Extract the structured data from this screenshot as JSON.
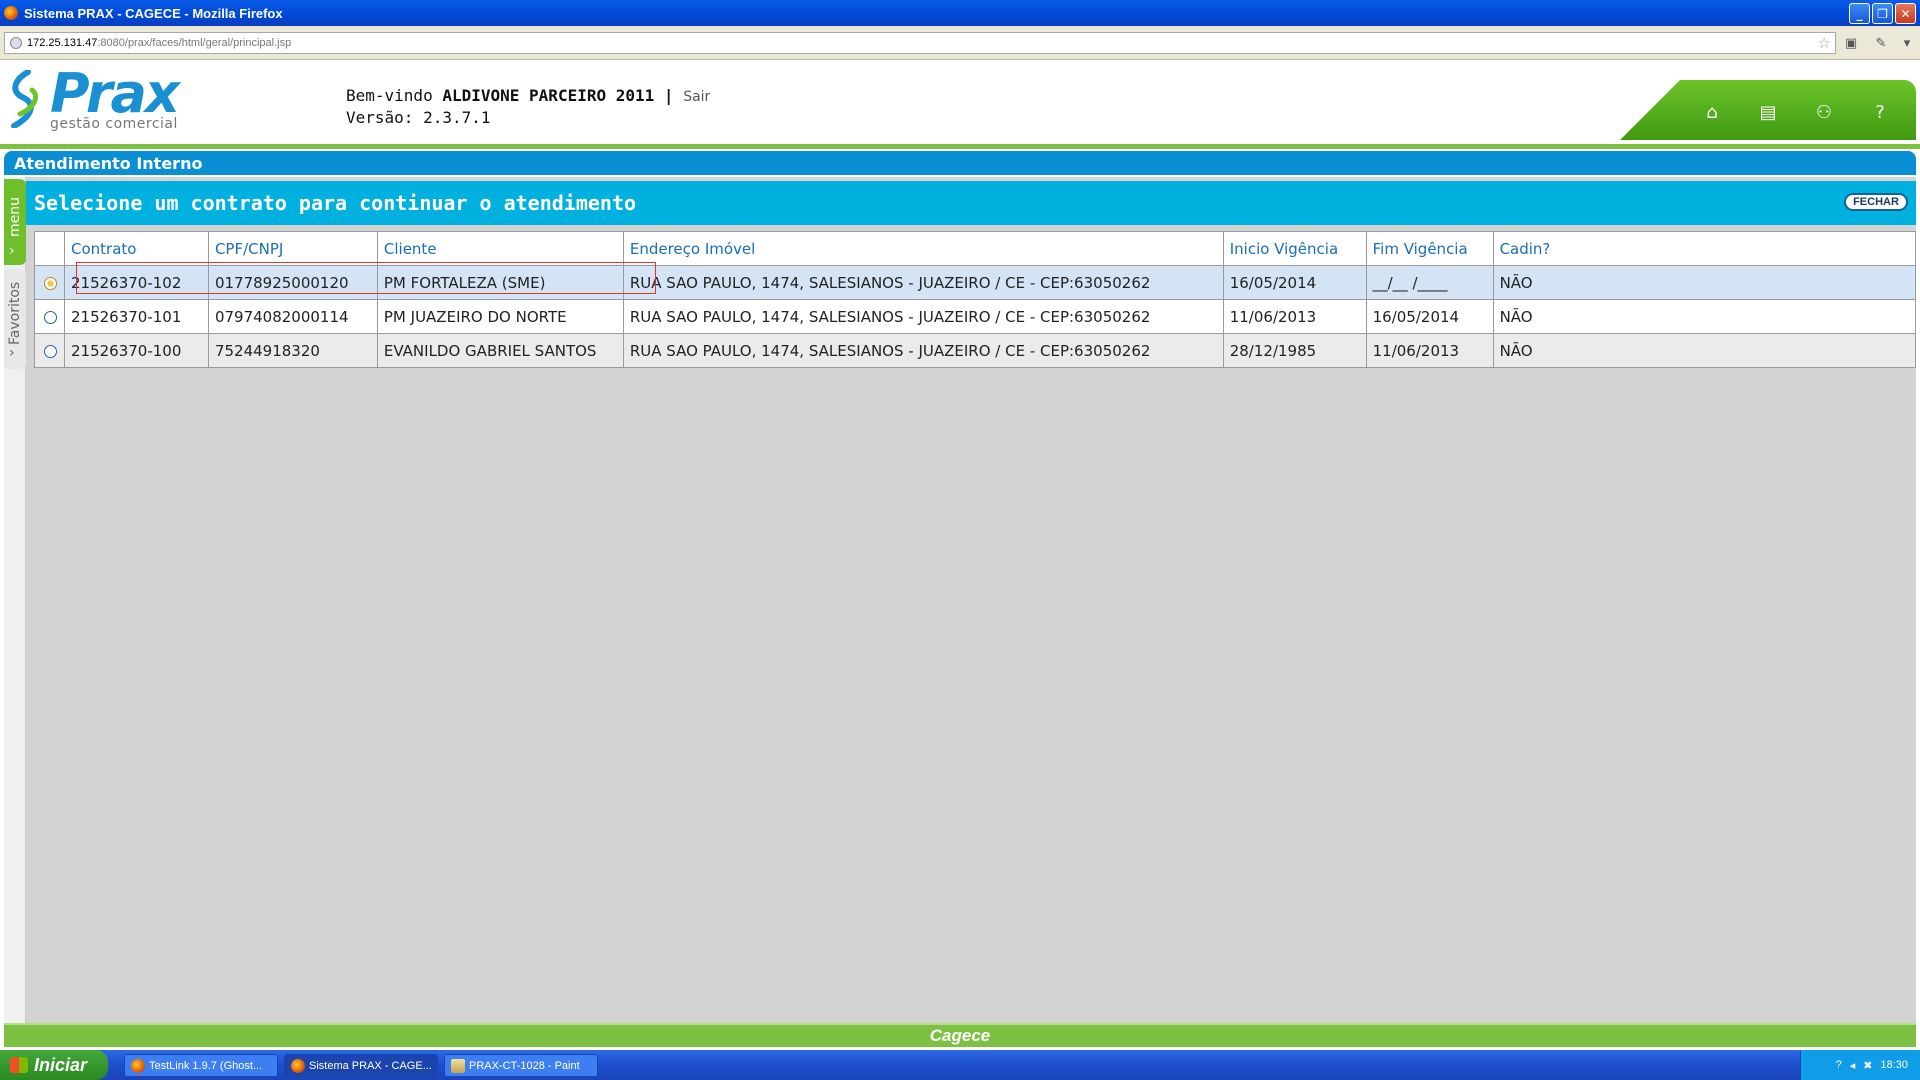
{
  "window": {
    "title": "Sistema PRAX - CAGECE - Mozilla Firefox",
    "buttons": {
      "minimize": "_",
      "maximize": "❐",
      "close": "✕"
    }
  },
  "browser": {
    "url_host": "172.25.131.47",
    "url_path": ":8080/prax/faces/html/geral/principal.jsp"
  },
  "header": {
    "logo_text": "Prax",
    "logo_subtitle": "gestão comercial",
    "welcome_prefix": "Bem-vindo",
    "user_name": "ALDIVONE PARCEIRO 2011",
    "separator": "|",
    "logout_label": "Sair",
    "version_label": "Versão: 2.3.7.1",
    "nav_icons": [
      "home-icon",
      "print-icon",
      "sitemap-icon",
      "help-icon"
    ]
  },
  "section": {
    "title": "Atendimento Interno"
  },
  "sidebar": {
    "menu_label": "menu",
    "favorites_label": "Favoritos"
  },
  "panel": {
    "title": "Selecione um contrato para continuar o atendimento",
    "close_label": "FECHAR"
  },
  "table": {
    "columns": [
      "",
      "Contrato",
      "CPF/CNPJ",
      "Cliente",
      "Endereço Imóvel",
      "Inicio Vigência",
      "Fim Vigência",
      "Cadin?"
    ],
    "rows": [
      {
        "selected": true,
        "contrato": "21526370-102",
        "cpf": "01778925000120",
        "cliente": "PM FORTALEZA (SME)",
        "endereco": "RUA SAO PAULO, 1474, SALESIANOS - JUAZEIRO / CE - CEP:63050262",
        "inicio": "16/05/2014",
        "fim": "__/__ /____",
        "cadin": "NÃO"
      },
      {
        "selected": false,
        "contrato": "21526370-101",
        "cpf": "07974082000114",
        "cliente": "PM JUAZEIRO DO NORTE",
        "endereco": "RUA SAO PAULO, 1474, SALESIANOS - JUAZEIRO / CE - CEP:63050262",
        "inicio": "11/06/2013",
        "fim": "16/05/2014",
        "cadin": "NÃO"
      },
      {
        "selected": false,
        "contrato": "21526370-100",
        "cpf": "75244918320",
        "cliente": "EVANILDO GABRIEL SANTOS",
        "endereco": "RUA SAO PAULO, 1474, SALESIANOS - JUAZEIRO / CE - CEP:63050262",
        "inicio": "28/12/1985",
        "fim": "11/06/2013",
        "cadin": "NÃO"
      }
    ]
  },
  "footer": {
    "brand": "Cagece"
  },
  "taskbar": {
    "start_label": "Iniciar",
    "items": [
      {
        "label": "TestLink 1.9.7 (Ghost..."
      },
      {
        "label": "Sistema PRAX - CAGE..."
      },
      {
        "label": "PRAX-CT-1028 - Paint"
      }
    ],
    "clock": "18:30"
  },
  "colors": {
    "brand_blue": "#0b8fd4",
    "panel_cyan": "#00b1e0",
    "brand_green": "#7dc142",
    "header_link": "#1a6db8",
    "highlight_red": "#e03030"
  }
}
